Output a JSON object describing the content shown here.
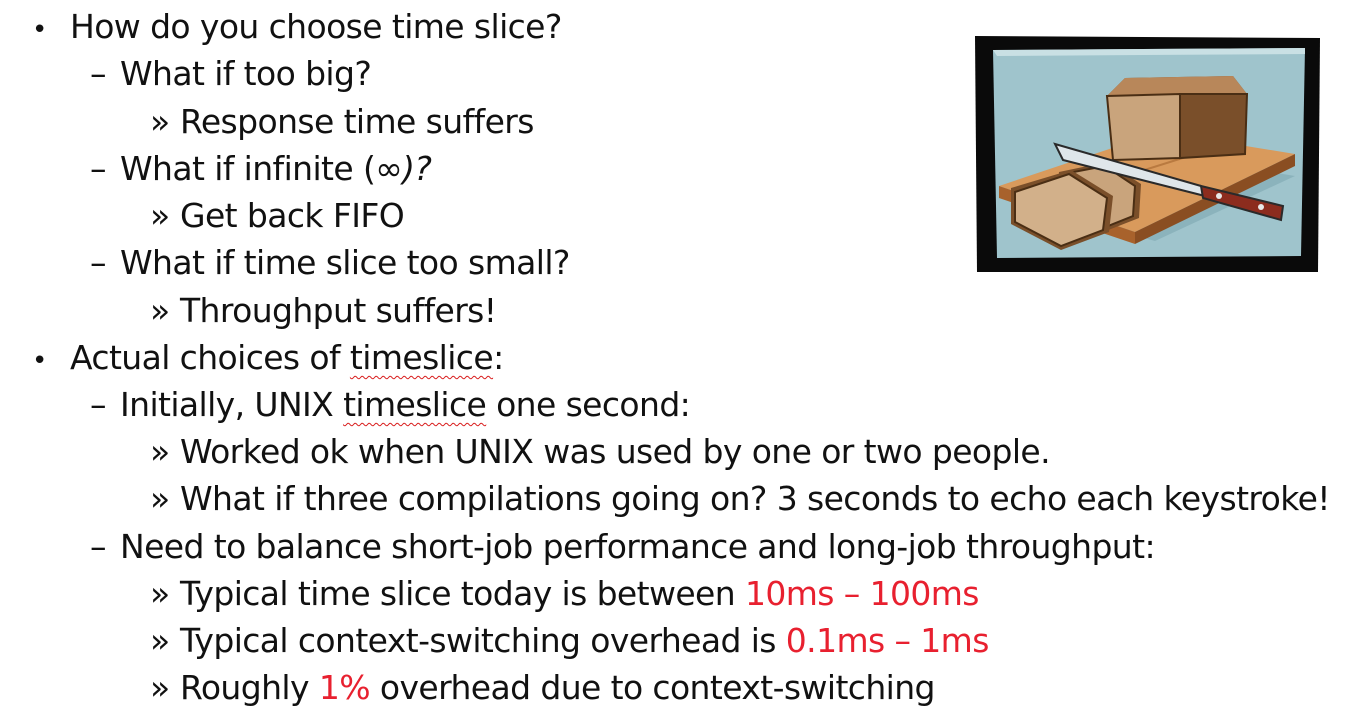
{
  "bullets": [
    {
      "marker": "•",
      "segments": [
        {
          "text": "How do you choose time slice?"
        }
      ]
    },
    {
      "marker": "–",
      "segments": [
        {
          "text": "What if too big?"
        }
      ]
    },
    {
      "marker": "»",
      "segments": [
        {
          "text": "Response time suffers"
        }
      ]
    },
    {
      "marker": "–",
      "segments": [
        {
          "text": "What if infinite ("
        },
        {
          "text": "∞",
          "italic": true
        },
        {
          "text": ")?",
          "italic": true
        }
      ]
    },
    {
      "marker": "»",
      "segments": [
        {
          "text": "Get back FIFO"
        }
      ]
    },
    {
      "marker": "–",
      "segments": [
        {
          "text": "What if time slice too small?"
        }
      ]
    },
    {
      "marker": "»",
      "segments": [
        {
          "text": "Throughput suffers!"
        }
      ]
    },
    {
      "marker": "•",
      "segments": [
        {
          "text": "Actual choices of "
        },
        {
          "text": "timeslice",
          "spell": true
        },
        {
          "text": ":"
        }
      ]
    },
    {
      "marker": "–",
      "segments": [
        {
          "text": "Initially, UNIX "
        },
        {
          "text": "timeslice",
          "spell": true
        },
        {
          "text": " one second:"
        }
      ]
    },
    {
      "marker": "»",
      "segments": [
        {
          "text": "Worked ok when UNIX was used by one or two people."
        }
      ]
    },
    {
      "marker": "»",
      "segments": [
        {
          "text": "What if three compilations going on? 3 seconds to echo each keystroke!"
        }
      ]
    },
    {
      "marker": "–",
      "segments": [
        {
          "text": "Need to balance short-job performance and long-job throughput:"
        }
      ]
    },
    {
      "marker": "»",
      "segments": [
        {
          "text": "Typical time slice today is between "
        },
        {
          "text": "10ms – 100ms",
          "red": true
        }
      ]
    },
    {
      "marker": "»",
      "segments": [
        {
          "text": "Typical context-switching overhead is "
        },
        {
          "text": "0.1ms – 1ms",
          "red": true
        }
      ]
    },
    {
      "marker": "»",
      "segments": [
        {
          "text": "Roughly "
        },
        {
          "text": "1%",
          "red": true
        },
        {
          "text": " overhead due to context-switching"
        }
      ]
    }
  ],
  "colors": {
    "highlight": "#e8202f",
    "text": "#111111"
  },
  "clipart": {
    "icon": "bread-and-knife-icon"
  }
}
